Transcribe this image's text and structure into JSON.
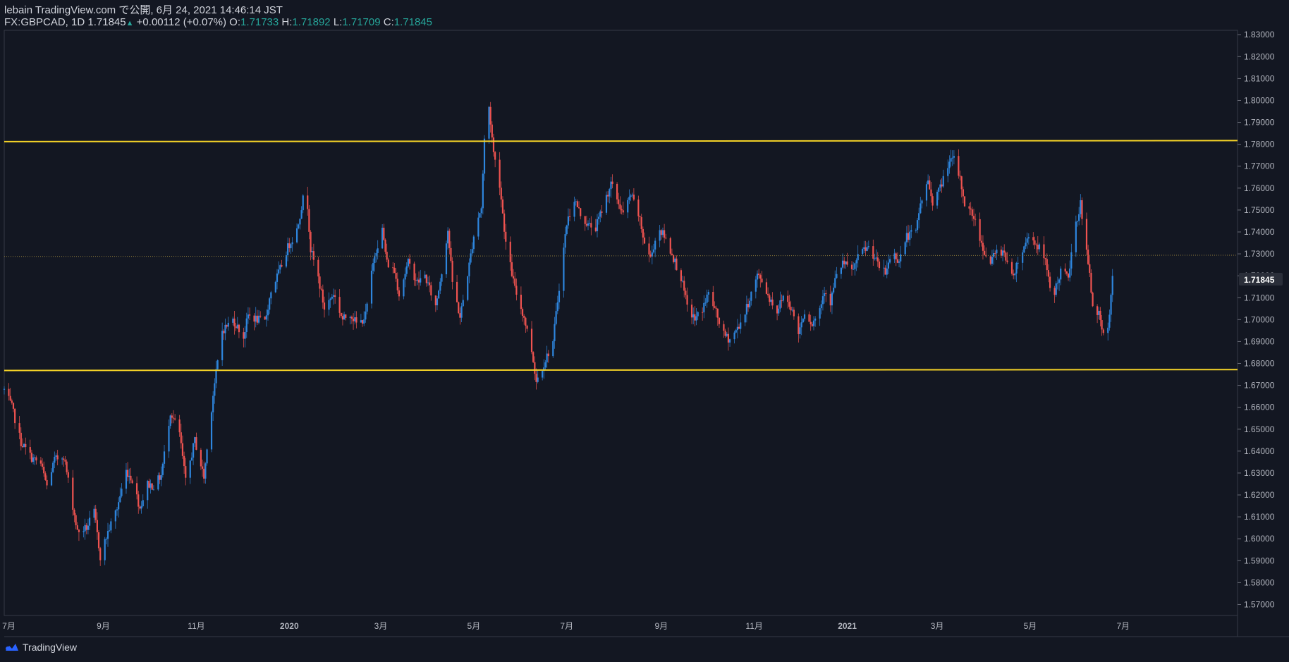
{
  "header": {
    "line1": "lebain TradingView.com で公開, 6月 24, 2021 14:46:14 JST",
    "symbol": "FX:GBPCAD, 1D",
    "last": "1.71845",
    "change": "+0.00112 (+0.07%)",
    "o_label": "O:",
    "o_value": "1.71733",
    "h_label": "H:",
    "h_value": "1.71892",
    "l_label": "L:",
    "l_value": "1.71709",
    "c_label": "C:",
    "c_value": "1.71845"
  },
  "footer": {
    "brand": "TradingView",
    "logo_icon": "tradingview-logo-icon"
  },
  "colors": {
    "background": "#131722",
    "up": "#2e86de",
    "down": "#ef5350",
    "level": "#f5d327",
    "dotted": "#8d7a3a",
    "text": "#d1d4dc",
    "value": "#26a69a"
  },
  "chart_data": {
    "type": "candlestick",
    "ylim": [
      1.565,
      1.832
    ],
    "y_ticks": [
      "1.83000",
      "1.82000",
      "1.81000",
      "1.80000",
      "1.79000",
      "1.78000",
      "1.77000",
      "1.76000",
      "1.75000",
      "1.74000",
      "1.73000",
      "1.72000",
      "1.71000",
      "1.70000",
      "1.69000",
      "1.68000",
      "1.67000",
      "1.66000",
      "1.65000",
      "1.64000",
      "1.63000",
      "1.62000",
      "1.61000",
      "1.60000",
      "1.59000",
      "1.58000",
      "1.57000"
    ],
    "x_labels": [
      {
        "label": "7月",
        "date": "2019-07-01"
      },
      {
        "label": "9月",
        "date": "2019-09-01"
      },
      {
        "label": "11月",
        "date": "2019-11-01"
      },
      {
        "label": "2020",
        "date": "2020-01-01"
      },
      {
        "label": "3月",
        "date": "2020-03-01"
      },
      {
        "label": "5月",
        "date": "2020-05-01"
      },
      {
        "label": "7月",
        "date": "2020-07-01"
      },
      {
        "label": "9月",
        "date": "2020-09-01"
      },
      {
        "label": "11月",
        "date": "2020-11-01"
      },
      {
        "label": "2021",
        "date": "2021-01-01"
      },
      {
        "label": "3月",
        "date": "2021-03-01"
      },
      {
        "label": "5月",
        "date": "2021-05-01"
      },
      {
        "label": "7月",
        "date": "2021-07-01"
      }
    ],
    "x_range": [
      "2019-06-28",
      "2021-09-14"
    ],
    "last_price": "1.71845",
    "horizontal_lines": [
      {
        "style": "solid",
        "from": {
          "date": "2019-06-28",
          "price": 1.7812
        },
        "to": {
          "date": "2021-09-14",
          "price": 1.7817
        }
      },
      {
        "style": "solid",
        "from": {
          "date": "2019-06-28",
          "price": 1.6768
        },
        "to": {
          "date": "2021-09-14",
          "price": 1.6772
        }
      },
      {
        "style": "dotted",
        "from": {
          "date": "2019-06-28",
          "price": 1.7288
        },
        "to": {
          "date": "2021-09-14",
          "price": 1.7294
        }
      }
    ],
    "path": [
      [
        "2019-06-28",
        1.668
      ],
      [
        "2019-07-03",
        1.66
      ],
      [
        "2019-07-09",
        1.644
      ],
      [
        "2019-07-16",
        1.637
      ],
      [
        "2019-07-22",
        1.634
      ],
      [
        "2019-07-26",
        1.624
      ],
      [
        "2019-07-31",
        1.636
      ],
      [
        "2019-08-06",
        1.638
      ],
      [
        "2019-08-12",
        1.615
      ],
      [
        "2019-08-15",
        1.603
      ],
      [
        "2019-08-21",
        1.605
      ],
      [
        "2019-08-26",
        1.612
      ],
      [
        "2019-08-30",
        1.592
      ],
      [
        "2019-09-04",
        1.603
      ],
      [
        "2019-09-10",
        1.614
      ],
      [
        "2019-09-16",
        1.631
      ],
      [
        "2019-09-20",
        1.627
      ],
      [
        "2019-09-25",
        1.614
      ],
      [
        "2019-09-30",
        1.625
      ],
      [
        "2019-10-04",
        1.624
      ],
      [
        "2019-10-09",
        1.629
      ],
      [
        "2019-10-15",
        1.658
      ],
      [
        "2019-10-21",
        1.648
      ],
      [
        "2019-10-25",
        1.626
      ],
      [
        "2019-10-31",
        1.645
      ],
      [
        "2019-11-06",
        1.628
      ],
      [
        "2019-11-12",
        1.666
      ],
      [
        "2019-11-18",
        1.695
      ],
      [
        "2019-11-25",
        1.7
      ],
      [
        "2019-12-02",
        1.692
      ],
      [
        "2019-12-05",
        1.702
      ],
      [
        "2019-12-11",
        1.7
      ],
      [
        "2019-12-16",
        1.699
      ],
      [
        "2019-12-20",
        1.713
      ],
      [
        "2019-12-26",
        1.723
      ],
      [
        "2019-12-31",
        1.733
      ],
      [
        "2020-01-06",
        1.741
      ],
      [
        "2020-01-10",
        1.755
      ],
      [
        "2020-01-13",
        1.752
      ],
      [
        "2020-01-15",
        1.732
      ],
      [
        "2020-01-20",
        1.719
      ],
      [
        "2020-01-24",
        1.705
      ],
      [
        "2020-01-30",
        1.712
      ],
      [
        "2020-02-05",
        1.7
      ],
      [
        "2020-02-10",
        1.703
      ],
      [
        "2020-02-15",
        1.697
      ],
      [
        "2020-02-20",
        1.702
      ],
      [
        "2020-02-26",
        1.73
      ],
      [
        "2020-03-02",
        1.741
      ],
      [
        "2020-03-05",
        1.726
      ],
      [
        "2020-03-10",
        1.722
      ],
      [
        "2020-03-13",
        1.712
      ],
      [
        "2020-03-19",
        1.726
      ],
      [
        "2020-03-25",
        1.717
      ],
      [
        "2020-03-30",
        1.72
      ],
      [
        "2020-04-06",
        1.706
      ],
      [
        "2020-04-10",
        1.722
      ],
      [
        "2020-04-14",
        1.741
      ],
      [
        "2020-04-17",
        1.717
      ],
      [
        "2020-04-22",
        1.701
      ],
      [
        "2020-04-28",
        1.725
      ],
      [
        "2020-05-02",
        1.743
      ],
      [
        "2020-05-06",
        1.751
      ],
      [
        "2020-05-08",
        1.782
      ],
      [
        "2020-05-11",
        1.797
      ],
      [
        "2020-05-14",
        1.776
      ],
      [
        "2020-05-18",
        1.762
      ],
      [
        "2020-05-22",
        1.735
      ],
      [
        "2020-05-28",
        1.714
      ],
      [
        "2020-06-03",
        1.701
      ],
      [
        "2020-06-08",
        1.686
      ],
      [
        "2020-06-11",
        1.672
      ],
      [
        "2020-06-16",
        1.68
      ],
      [
        "2020-06-22",
        1.69
      ],
      [
        "2020-06-26",
        1.715
      ],
      [
        "2020-07-01",
        1.744
      ],
      [
        "2020-07-06",
        1.755
      ],
      [
        "2020-07-10",
        1.748
      ],
      [
        "2020-07-15",
        1.743
      ],
      [
        "2020-07-20",
        1.742
      ],
      [
        "2020-07-25",
        1.752
      ],
      [
        "2020-07-30",
        1.762
      ],
      [
        "2020-08-03",
        1.755
      ],
      [
        "2020-08-07",
        1.748
      ],
      [
        "2020-08-12",
        1.757
      ],
      [
        "2020-08-17",
        1.748
      ],
      [
        "2020-08-21",
        1.735
      ],
      [
        "2020-08-25",
        1.728
      ],
      [
        "2020-08-30",
        1.742
      ],
      [
        "2020-09-03",
        1.738
      ],
      [
        "2020-09-08",
        1.73
      ],
      [
        "2020-09-14",
        1.719
      ],
      [
        "2020-09-18",
        1.706
      ],
      [
        "2020-09-23",
        1.7
      ],
      [
        "2020-09-28",
        1.705
      ],
      [
        "2020-10-02",
        1.712
      ],
      [
        "2020-10-07",
        1.703
      ],
      [
        "2020-10-12",
        1.693
      ],
      [
        "2020-10-16",
        1.691
      ],
      [
        "2020-10-21",
        1.696
      ],
      [
        "2020-10-26",
        1.703
      ],
      [
        "2020-10-30",
        1.712
      ],
      [
        "2020-11-03",
        1.72
      ],
      [
        "2020-11-06",
        1.718
      ],
      [
        "2020-11-10",
        1.711
      ],
      [
        "2020-11-16",
        1.704
      ],
      [
        "2020-11-20",
        1.711
      ],
      [
        "2020-11-25",
        1.706
      ],
      [
        "2020-11-30",
        1.694
      ],
      [
        "2020-12-04",
        1.704
      ],
      [
        "2020-12-09",
        1.698
      ],
      [
        "2020-12-14",
        1.705
      ],
      [
        "2020-12-17",
        1.714
      ],
      [
        "2020-12-21",
        1.708
      ],
      [
        "2020-12-24",
        1.718
      ],
      [
        "2020-12-29",
        1.726
      ],
      [
        "2021-01-04",
        1.722
      ],
      [
        "2021-01-08",
        1.728
      ],
      [
        "2021-01-12",
        1.732
      ],
      [
        "2021-01-16",
        1.733
      ],
      [
        "2021-01-21",
        1.725
      ],
      [
        "2021-01-26",
        1.721
      ],
      [
        "2021-01-30",
        1.731
      ],
      [
        "2021-02-04",
        1.727
      ],
      [
        "2021-02-09",
        1.738
      ],
      [
        "2021-02-15",
        1.74
      ],
      [
        "2021-02-18",
        1.753
      ],
      [
        "2021-02-23",
        1.763
      ],
      [
        "2021-02-26",
        1.754
      ],
      [
        "2021-03-03",
        1.76
      ],
      [
        "2021-03-08",
        1.771
      ],
      [
        "2021-03-12",
        1.773
      ],
      [
        "2021-03-16",
        1.764
      ],
      [
        "2021-03-19",
        1.753
      ],
      [
        "2021-03-25",
        1.747
      ],
      [
        "2021-03-30",
        1.735
      ],
      [
        "2021-04-04",
        1.725
      ],
      [
        "2021-04-09",
        1.731
      ],
      [
        "2021-04-14",
        1.731
      ],
      [
        "2021-04-19",
        1.719
      ],
      [
        "2021-04-23",
        1.727
      ],
      [
        "2021-04-27",
        1.733
      ],
      [
        "2021-04-30",
        1.739
      ],
      [
        "2021-05-04",
        1.735
      ],
      [
        "2021-05-08",
        1.732
      ],
      [
        "2021-05-11",
        1.726
      ],
      [
        "2021-05-14",
        1.714
      ],
      [
        "2021-05-17",
        1.713
      ],
      [
        "2021-05-21",
        1.722
      ],
      [
        "2021-05-26",
        1.719
      ],
      [
        "2021-05-28",
        1.73
      ],
      [
        "2021-06-01",
        1.747
      ],
      [
        "2021-06-03",
        1.753
      ],
      [
        "2021-06-07",
        1.731
      ],
      [
        "2021-06-11",
        1.708
      ],
      [
        "2021-06-15",
        1.702
      ],
      [
        "2021-06-18",
        1.692
      ],
      [
        "2021-06-21",
        1.695
      ],
      [
        "2021-06-24",
        1.7185
      ]
    ]
  }
}
